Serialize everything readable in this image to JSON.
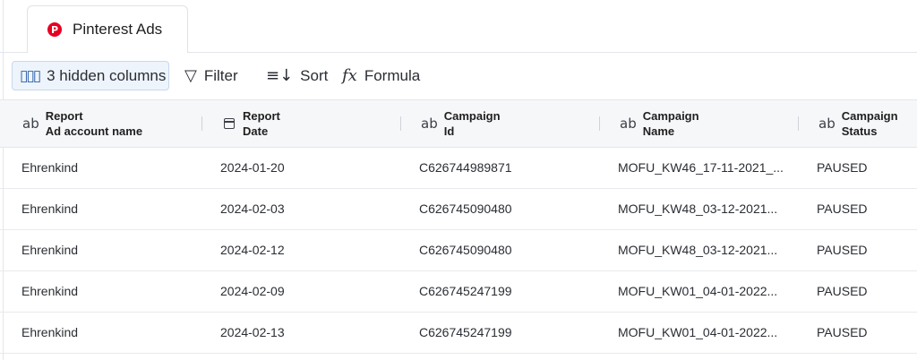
{
  "tab": {
    "label": "Pinterest Ads",
    "icon": "pinterest-icon",
    "icon_glyph": "P",
    "brand_color": "#e60023"
  },
  "toolbar": {
    "hidden_columns": "3 hidden columns",
    "filter": "Filter",
    "sort": "Sort",
    "formula": "Formula"
  },
  "columns": [
    {
      "icon": "text-type-icon",
      "glyph": "ab",
      "line1": "Report",
      "line2": "Ad account name"
    },
    {
      "icon": "calendar-icon",
      "glyph": "",
      "line1": "Report",
      "line2": "Date"
    },
    {
      "icon": "text-type-icon",
      "glyph": "ab",
      "line1": "Campaign",
      "line2": "Id"
    },
    {
      "icon": "text-type-icon",
      "glyph": "ab",
      "line1": "Campaign",
      "line2": "Name"
    },
    {
      "icon": "text-type-icon",
      "glyph": "ab",
      "line1": "Campaign",
      "line2": "Status"
    }
  ],
  "rows": [
    [
      "Ehrenkind",
      "2024-01-20",
      "C626744989871",
      "MOFU_KW46_17-11-2021_...",
      "PAUSED"
    ],
    [
      "Ehrenkind",
      "2024-02-03",
      "C626745090480",
      "MOFU_KW48_03-12-2021...",
      "PAUSED"
    ],
    [
      "Ehrenkind",
      "2024-02-12",
      "C626745090480",
      "MOFU_KW48_03-12-2021...",
      "PAUSED"
    ],
    [
      "Ehrenkind",
      "2024-02-09",
      "C626745247199",
      "MOFU_KW01_04-01-2022...",
      "PAUSED"
    ],
    [
      "Ehrenkind",
      "2024-02-13",
      "C626745247199",
      "MOFU_KW01_04-01-2022...",
      "PAUSED"
    ]
  ]
}
